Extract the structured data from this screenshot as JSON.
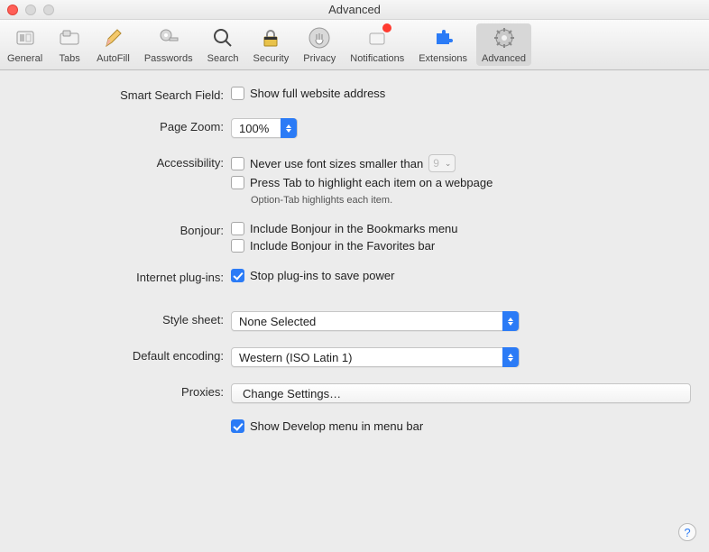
{
  "window_title": "Advanced",
  "toolbar": [
    {
      "id": "general",
      "label": "General"
    },
    {
      "id": "tabs",
      "label": "Tabs"
    },
    {
      "id": "autofill",
      "label": "AutoFill"
    },
    {
      "id": "passwords",
      "label": "Passwords"
    },
    {
      "id": "search",
      "label": "Search"
    },
    {
      "id": "security",
      "label": "Security"
    },
    {
      "id": "privacy",
      "label": "Privacy"
    },
    {
      "id": "notifications",
      "label": "Notifications"
    },
    {
      "id": "extensions",
      "label": "Extensions"
    },
    {
      "id": "advanced",
      "label": "Advanced"
    }
  ],
  "smart_search": {
    "label": "Smart Search Field:",
    "show_full_address_label": "Show full website address",
    "show_full_address_checked": false
  },
  "page_zoom": {
    "label": "Page Zoom:",
    "value": "100%"
  },
  "accessibility": {
    "label": "Accessibility:",
    "never_font_label": "Never use font sizes smaller than",
    "never_font_checked": false,
    "min_font_value": "9",
    "press_tab_label": "Press Tab to highlight each item on a webpage",
    "press_tab_checked": false,
    "hint": "Option-Tab highlights each item."
  },
  "bonjour": {
    "label": "Bonjour:",
    "bookmarks_label": "Include Bonjour in the Bookmarks menu",
    "bookmarks_checked": false,
    "favorites_label": "Include Bonjour in the Favorites bar",
    "favorites_checked": false
  },
  "plugins": {
    "label": "Internet plug-ins:",
    "stop_label": "Stop plug-ins to save power",
    "stop_checked": true
  },
  "style_sheet": {
    "label": "Style sheet:",
    "value": "None Selected"
  },
  "default_encoding": {
    "label": "Default encoding:",
    "value": "Western (ISO Latin 1)"
  },
  "proxies": {
    "label": "Proxies:",
    "button": "Change Settings…"
  },
  "develop": {
    "label": "Show Develop menu in menu bar",
    "checked": true
  },
  "help": "?"
}
